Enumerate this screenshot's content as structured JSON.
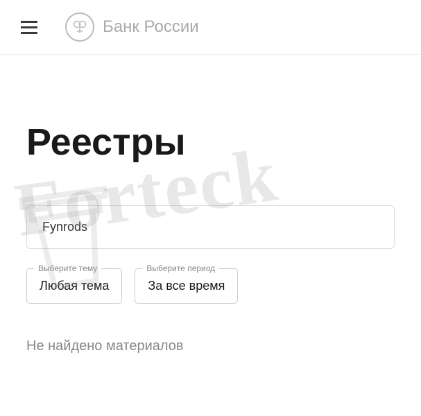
{
  "header": {
    "brand": "Банк России"
  },
  "page": {
    "title": "Реестры"
  },
  "search": {
    "value": "Fynrods"
  },
  "filters": {
    "topic": {
      "label": "Выберите тему",
      "value": "Любая тема"
    },
    "period": {
      "label": "Выберите период",
      "value": "За все время"
    }
  },
  "results": {
    "empty_message": "Не найдено материалов"
  },
  "watermark": {
    "text": "Forteck"
  }
}
